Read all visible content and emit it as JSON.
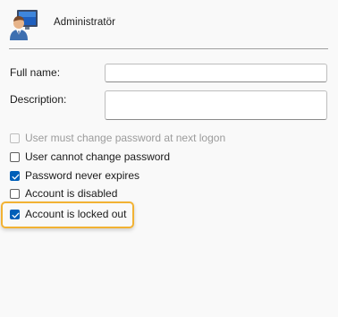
{
  "header": {
    "user_name": "Administratör",
    "avatar_icon": "user-account-icon"
  },
  "form": {
    "full_name_label": "Full name:",
    "full_name_value": "",
    "description_label": "Description:",
    "description_value": ""
  },
  "options": [
    {
      "label": "User must change password at next logon",
      "checked": false,
      "enabled": false
    },
    {
      "label": "User cannot change password",
      "checked": false,
      "enabled": true
    },
    {
      "label": "Password never expires",
      "checked": true,
      "enabled": true
    },
    {
      "label": "Account is disabled",
      "checked": false,
      "enabled": true
    },
    {
      "label": "Account is locked out",
      "checked": true,
      "enabled": true
    }
  ],
  "colors": {
    "accent": "#005fb8",
    "highlight": "#f2b233"
  }
}
